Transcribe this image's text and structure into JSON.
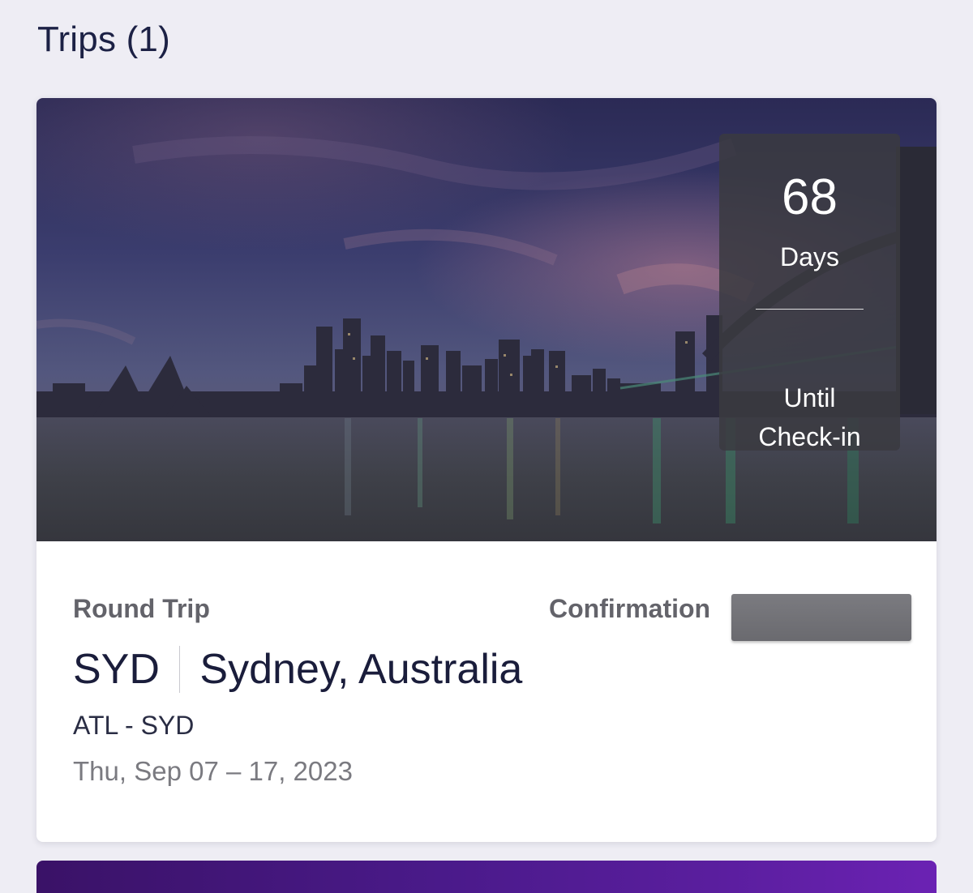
{
  "page": {
    "title": "Trips (1)"
  },
  "trip": {
    "countdown": {
      "number": "68",
      "unit": "Days",
      "caption_line1": "Until",
      "caption_line2": "Check-in"
    },
    "trip_type": "Round Trip",
    "confirmation_label": "Confirmation",
    "destination_code": "SYD",
    "destination_name": "Sydney, Australia",
    "route": "ATL - SYD",
    "dates": "Thu, Sep 07 – 17, 2023"
  }
}
